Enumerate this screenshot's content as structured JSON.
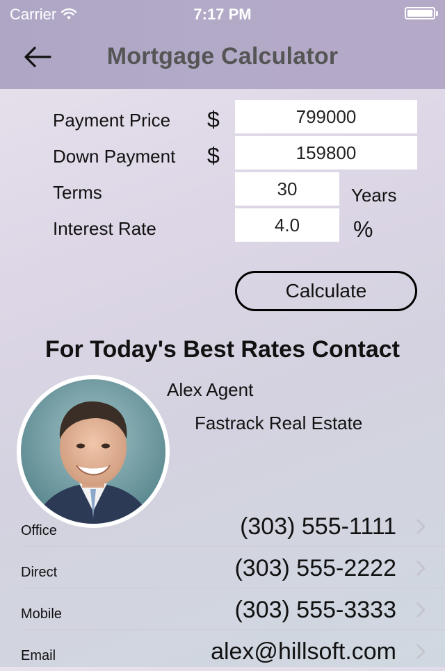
{
  "status_bar": {
    "carrier": "Carrier",
    "time": "7:17 PM"
  },
  "nav": {
    "title": "Mortgage Calculator"
  },
  "form": {
    "payment_price": {
      "label": "Payment Price",
      "currency": "$",
      "value": "799000"
    },
    "down_payment": {
      "label": "Down Payment",
      "currency": "$",
      "value": "159800"
    },
    "terms": {
      "label": "Terms",
      "value": "30",
      "unit": "Years"
    },
    "interest_rate": {
      "label": "Interest Rate",
      "value": "4.0",
      "unit": "%"
    },
    "calculate_label": "Calculate"
  },
  "contact": {
    "heading": "For Today's Best Rates Contact",
    "name": "Alex Agent",
    "company": "Fastrack Real Estate",
    "rows": [
      {
        "label": "Office",
        "value": "(303) 555-1111"
      },
      {
        "label": "Direct",
        "value": "(303) 555-2222"
      },
      {
        "label": "Mobile",
        "value": "(303) 555-3333"
      },
      {
        "label": "Email",
        "value": "alex@hillsoft.com"
      }
    ]
  }
}
